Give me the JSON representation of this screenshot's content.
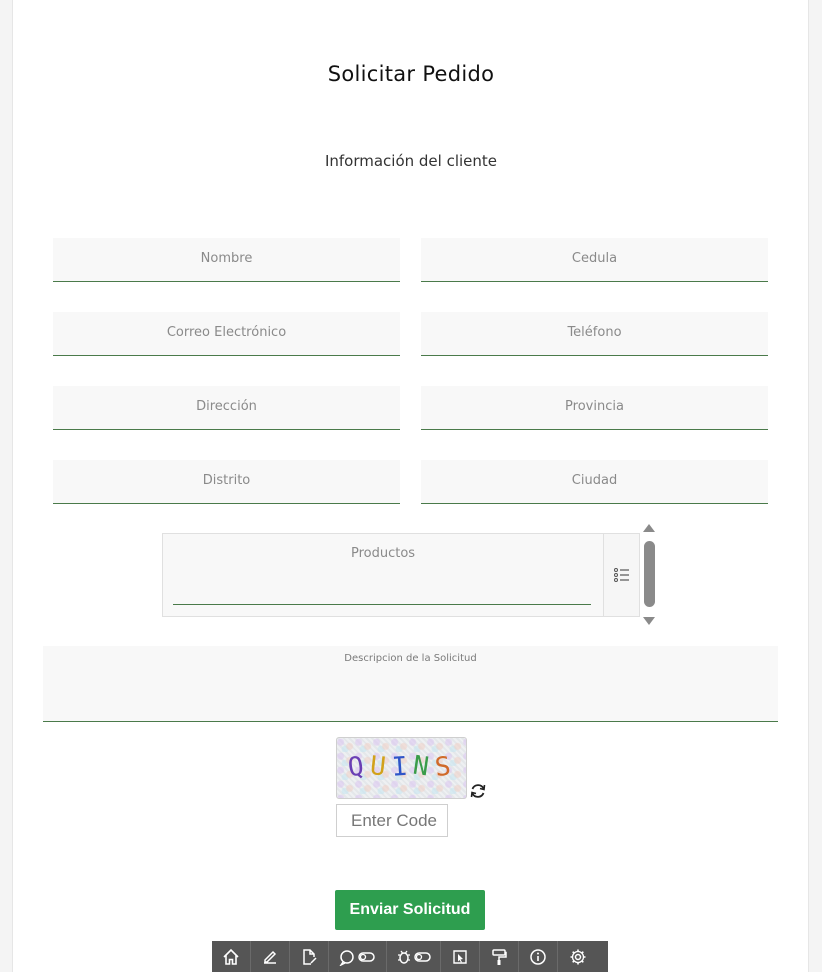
{
  "page": {
    "title": "Solicitar Pedido",
    "section_title": "Información del cliente"
  },
  "form": {
    "nombre": "Nombre",
    "cedula": "Cedula",
    "correo": "Correo Electrónico",
    "telefono": "Teléfono",
    "direccion": "Dirección",
    "provincia": "Provincia",
    "distrito": "Distrito",
    "ciudad": "Ciudad",
    "productos": "Productos",
    "descripcion": "Descripcion de la Solicitud"
  },
  "captcha": {
    "chars": [
      "Q",
      "U",
      "I",
      "N",
      "S"
    ],
    "placeholder": "Enter Code"
  },
  "submit_label": "Enviar Solicitud",
  "toolbar": {
    "icons": [
      "home-icon",
      "edit-icon",
      "file-edit-icon",
      "comment-toggle-icon",
      "bug-toggle-icon",
      "cursor-select-icon",
      "paint-roller-icon",
      "info-icon",
      "settings-icon"
    ]
  },
  "colors": {
    "accent_green": "#2e9e4f",
    "field_underline": "#4a7a4a",
    "toolbar_bg": "#555555"
  }
}
